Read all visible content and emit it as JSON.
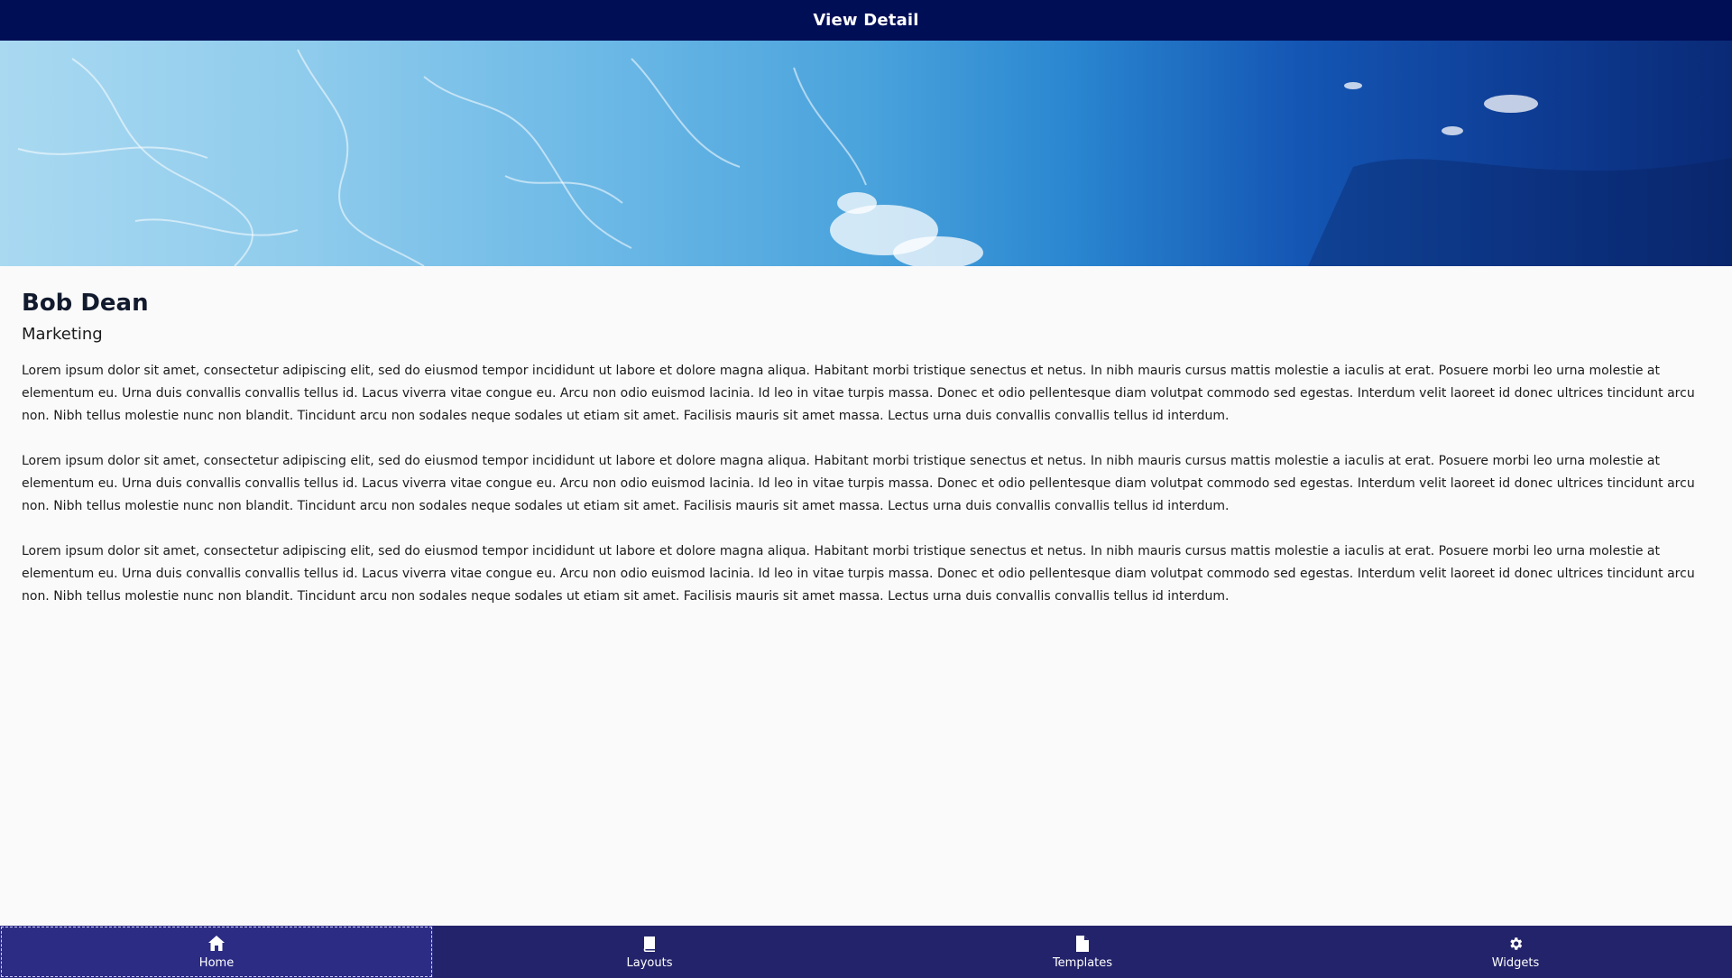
{
  "header": {
    "title": "View Detail"
  },
  "hero": {
    "image": "ocean-wave-image"
  },
  "profile": {
    "name": "Bob Dean",
    "department": "Marketing"
  },
  "body": {
    "paragraphs": [
      "Lorem ipsum dolor sit amet, consectetur adipiscing elit, sed do eiusmod tempor incididunt ut labore et dolore magna aliqua. Habitant morbi tristique senectus et netus. In nibh mauris cursus mattis molestie a iaculis at erat. Posuere morbi leo urna molestie at elementum eu. Urna duis convallis convallis tellus id. Lacus viverra vitae congue eu. Arcu non odio euismod lacinia. Id leo in vitae turpis massa. Donec et odio pellentesque diam volutpat commodo sed egestas. Interdum velit laoreet id donec ultrices tincidunt arcu non. Nibh tellus molestie nunc non blandit. Tincidunt arcu non sodales neque sodales ut etiam sit amet. Facilisis mauris sit amet massa. Lectus urna duis convallis convallis tellus id interdum.",
      "Lorem ipsum dolor sit amet, consectetur adipiscing elit, sed do eiusmod tempor incididunt ut labore et dolore magna aliqua. Habitant morbi tristique senectus et netus. In nibh mauris cursus mattis molestie a iaculis at erat. Posuere morbi leo urna molestie at elementum eu. Urna duis convallis convallis tellus id. Lacus viverra vitae congue eu. Arcu non odio euismod lacinia. Id leo in vitae turpis massa. Donec et odio pellentesque diam volutpat commodo sed egestas. Interdum velit laoreet id donec ultrices tincidunt arcu non. Nibh tellus molestie nunc non blandit. Tincidunt arcu non sodales neque sodales ut etiam sit amet. Facilisis mauris sit amet massa. Lectus urna duis convallis convallis tellus id interdum.",
      "Lorem ipsum dolor sit amet, consectetur adipiscing elit, sed do eiusmod tempor incididunt ut labore et dolore magna aliqua. Habitant morbi tristique senectus et netus. In nibh mauris cursus mattis molestie a iaculis at erat. Posuere morbi leo urna molestie at elementum eu. Urna duis convallis convallis tellus id. Lacus viverra vitae congue eu. Arcu non odio euismod lacinia. Id leo in vitae turpis massa. Donec et odio pellentesque diam volutpat commodo sed egestas. Interdum velit laoreet id donec ultrices tincidunt arcu non. Nibh tellus molestie nunc non blandit. Tincidunt arcu non sodales neque sodales ut etiam sit amet. Facilisis mauris sit amet massa. Lectus urna duis convallis convallis tellus id interdum."
    ]
  },
  "nav": {
    "items": [
      {
        "label": "Home",
        "icon": "home-icon",
        "active": true
      },
      {
        "label": "Layouts",
        "icon": "book-icon",
        "active": false
      },
      {
        "label": "Templates",
        "icon": "document-icon",
        "active": false
      },
      {
        "label": "Widgets",
        "icon": "gear-icon",
        "active": false
      }
    ]
  },
  "colors": {
    "header_bg": "#000e56",
    "nav_bg": "#23236b",
    "nav_active_bg": "#2c2c85",
    "page_bg": "#fafafa"
  }
}
